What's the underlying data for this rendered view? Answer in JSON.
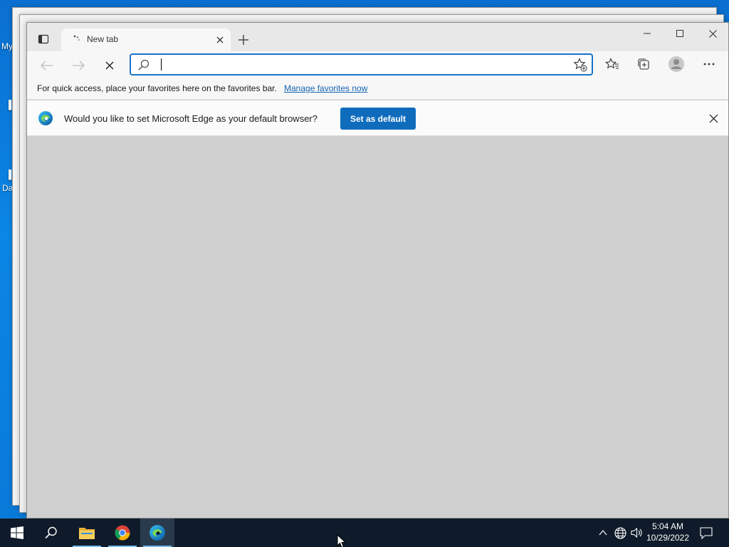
{
  "desktop": {
    "labels": [
      "My",
      "Da"
    ]
  },
  "browser": {
    "tab": {
      "title": "New tab",
      "loading_icon": "loading-dots-icon",
      "close_icon": "close-icon"
    },
    "new_tab_icon": "plus-icon",
    "window_controls": {
      "minimize": "minimize-icon",
      "maximize": "maximize-icon",
      "close": "close-icon"
    },
    "toolbar": {
      "back_icon": "arrow-left-icon",
      "forward_icon": "arrow-right-icon",
      "stop_icon": "close-icon",
      "address": {
        "value": "",
        "placeholder": "",
        "search_icon": "search-icon",
        "add_favorite_icon": "star-add-icon"
      },
      "favorites_icon": "favorites-icon",
      "collections_icon": "collections-icon",
      "profile_icon": "avatar-icon",
      "menu_icon": "more-icon"
    },
    "favorites_bar": {
      "text": "For quick access, place your favorites here on the favorites bar.",
      "link": "Manage favorites now"
    },
    "infobar": {
      "message": "Would you like to set Microsoft Edge as your default browser?",
      "button": "Set as default",
      "close_icon": "close-icon"
    }
  },
  "taskbar": {
    "apps": [
      {
        "name": "Start",
        "icon": "windows-icon"
      },
      {
        "name": "Search",
        "icon": "search-icon"
      },
      {
        "name": "File Explorer",
        "icon": "folder-icon"
      },
      {
        "name": "Google Chrome",
        "icon": "chrome-icon"
      },
      {
        "name": "Microsoft Edge",
        "icon": "edge-icon"
      }
    ],
    "tray": {
      "icons": [
        "chevron-up-icon",
        "network-icon",
        "volume-icon"
      ]
    },
    "clock": {
      "time": "5:04 AM",
      "date": "10/29/2022"
    },
    "notification_icon": "action-center-icon"
  },
  "colors": {
    "accent": "#0f6cbd",
    "address_border": "#1a73c8",
    "link": "#1463b5",
    "taskbar": "#0f1b2a",
    "content_bg": "#cfcfcf"
  }
}
